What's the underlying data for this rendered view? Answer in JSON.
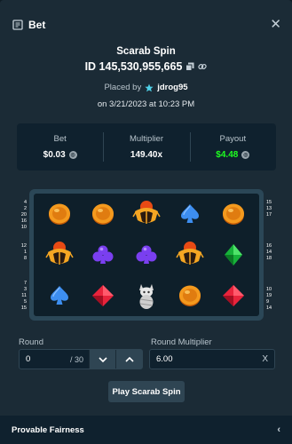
{
  "header": {
    "title": "Bet",
    "icons": {
      "bet": "receipt-icon",
      "close": "close-icon"
    }
  },
  "bet": {
    "game": "Scarab Spin",
    "id": "ID 145,530,955,665",
    "placed_by_prefix": "Placed by",
    "user": "jdrog95",
    "date": "on 3/21/2023 at 10:23 PM"
  },
  "stats": {
    "bet_label": "Bet",
    "bet_value": "$0.03",
    "multiplier_label": "Multiplier",
    "multiplier_value": "149.40x",
    "payout_label": "Payout",
    "payout_value": "$4.48",
    "payout_color": "#1fff20"
  },
  "paylines": {
    "left": [
      "4",
      "2",
      "20",
      "16",
      "10",
      "",
      "",
      "12",
      "1",
      "8",
      "",
      "",
      "",
      "7",
      "3",
      "11",
      "5",
      "15"
    ],
    "right": [
      "15",
      "13",
      "17",
      "",
      "",
      "",
      "",
      "16",
      "14",
      "18",
      "",
      "",
      "",
      "",
      "10",
      "19",
      "9",
      "14"
    ]
  },
  "reels": [
    [
      "coin",
      "coin",
      "scarab",
      "spade",
      "coin"
    ],
    [
      "scarab",
      "club",
      "club",
      "scarab",
      "green-diamond"
    ],
    [
      "spade",
      "diamond",
      "mummy-cat",
      "coin",
      "diamond"
    ]
  ],
  "controls": {
    "round_label": "Round",
    "round_value": "0",
    "round_total": "/ 30",
    "multiplier_label": "Round Multiplier",
    "multiplier_value": "6.00",
    "clear": "X",
    "play": "Play Scarab Spin"
  },
  "footer": {
    "fairness": "Provable Fairness",
    "chevron": "‹"
  }
}
